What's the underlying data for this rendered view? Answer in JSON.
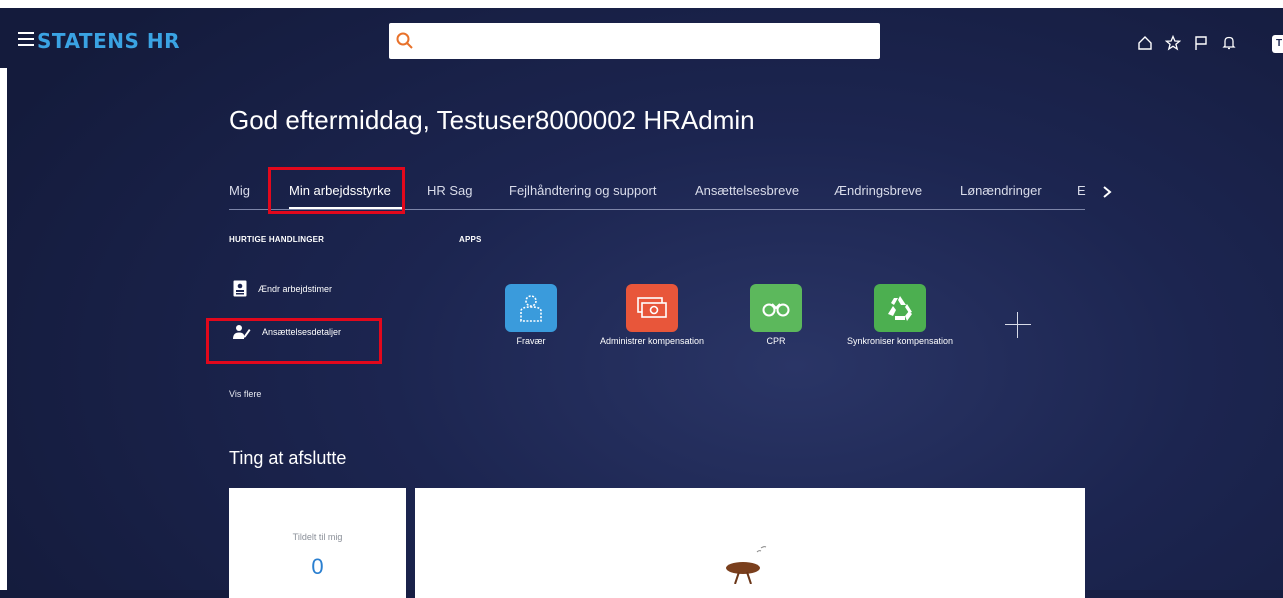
{
  "header": {
    "brand": "STATENS HR",
    "search_placeholder": "",
    "icons": [
      "home-icon",
      "star-icon",
      "flag-icon",
      "bell-icon"
    ],
    "avatar_initial": "T"
  },
  "greeting": "God eftermiddag, Testuser8000002 HRAdmin",
  "tabs": [
    {
      "label": "Mig"
    },
    {
      "label": "Min arbejdsstyrke",
      "active": true
    },
    {
      "label": "HR Sag"
    },
    {
      "label": "Fejlhåndtering og support"
    },
    {
      "label": "Ansættelsesbreve"
    },
    {
      "label": "Ændringsbreve"
    },
    {
      "label": "Lønændringer"
    },
    {
      "label": "E"
    }
  ],
  "quick_actions": {
    "heading": "HURTIGE HANDLINGER",
    "items": [
      {
        "label": "Ændr arbejdstimer",
        "icon": "badge-icon"
      },
      {
        "label": "Ansættelsesdetaljer",
        "icon": "user-edit-icon"
      }
    ],
    "more": "Vis flere"
  },
  "apps": {
    "heading": "APPS",
    "items": [
      {
        "label": "Fravær",
        "icon": "person-outline-icon",
        "color": "#3a9bdc"
      },
      {
        "label": "Administrer kompensation",
        "icon": "cash-icon",
        "color": "#e8563a"
      },
      {
        "label": "CPR",
        "icon": "binoculars-icon",
        "color": "#5cb85c"
      },
      {
        "label": "Synkroniser kompensation",
        "icon": "recycle-icon",
        "color": "#4caf50"
      }
    ]
  },
  "things": {
    "heading": "Ting at afslutte",
    "assigned_label": "Tildelt til mig",
    "assigned_count": "0"
  },
  "colors": {
    "brand": "#3aa3e3",
    "highlight": "#e2081c",
    "background": "#1c2550"
  }
}
